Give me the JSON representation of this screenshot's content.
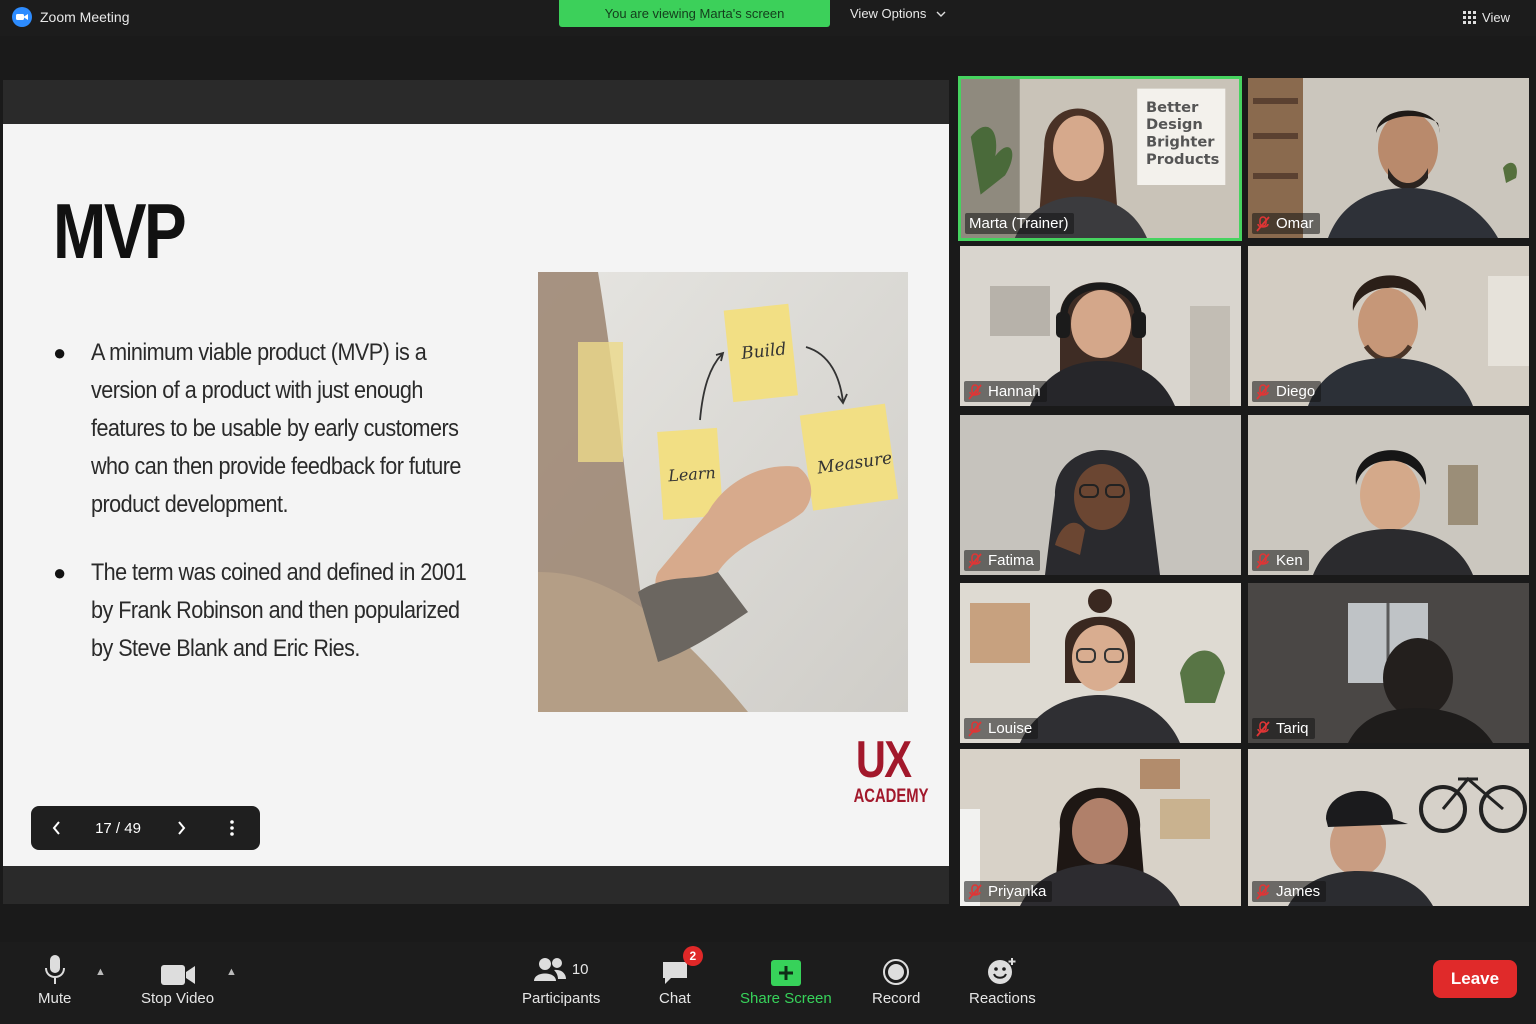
{
  "app": {
    "title": "Zoom Meeting"
  },
  "banner": {
    "viewing": "You are viewing Marta's screen"
  },
  "top": {
    "view_options": "View Options",
    "view": "View"
  },
  "slide": {
    "title": "MVP",
    "bullets": [
      "A minimum viable product (MVP) is a version of a product with just enough features to be usable by early customers who can then provide feedback for future product development.",
      "The term was coined and defined in 2001 by Frank Robinson and then popularized by Steve Blank and Eric Ries."
    ],
    "photo_notes": [
      "Build",
      "Measure",
      "Learn"
    ],
    "logo": {
      "ux": "UX",
      "academy": "ACADEMY"
    },
    "page_indicator": "17 / 49"
  },
  "participants": [
    {
      "name": "Marta (Trainer)",
      "muted": false,
      "active": true,
      "poster": [
        "Better",
        "Design",
        "Brighter",
        "Products"
      ]
    },
    {
      "name": "Omar",
      "muted": true
    },
    {
      "name": "Hannah",
      "muted": true
    },
    {
      "name": "Diego",
      "muted": true
    },
    {
      "name": "Fatima",
      "muted": true
    },
    {
      "name": "Ken",
      "muted": true
    },
    {
      "name": "Louise",
      "muted": true
    },
    {
      "name": "Tariq",
      "muted": true
    },
    {
      "name": "Priyanka",
      "muted": true
    },
    {
      "name": "James",
      "muted": true
    }
  ],
  "toolbar": {
    "mute": "Mute",
    "stop_video": "Stop Video",
    "participants": "Participants",
    "participants_count": "10",
    "chat": "Chat",
    "chat_badge": "2",
    "share_screen": "Share Screen",
    "record": "Record",
    "reactions": "Reactions",
    "leave": "Leave"
  },
  "colors": {
    "share_green": "#3cd05a",
    "active_border": "#46d35f",
    "leave_red": "#e02a2a",
    "logo_red": "#a2182b",
    "zoom_blue": "#2d8cff"
  }
}
